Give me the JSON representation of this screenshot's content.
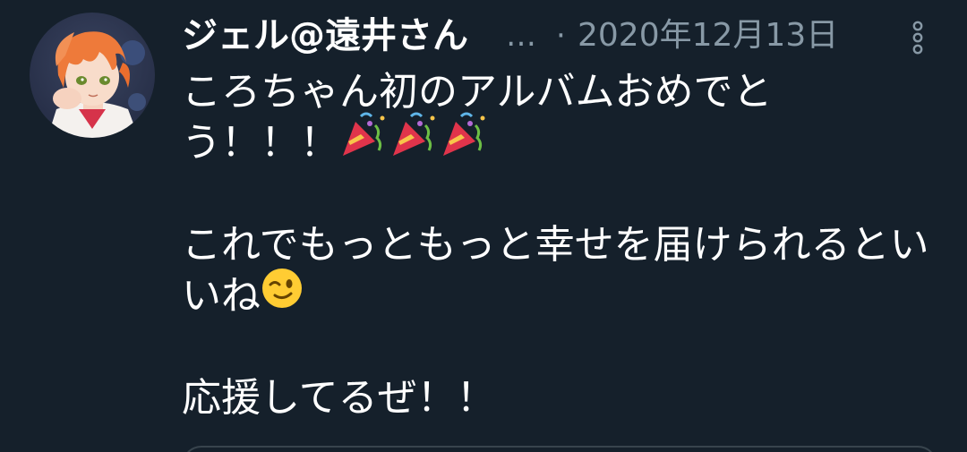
{
  "tweet": {
    "display_name": "ジェル@遠井さん",
    "name_truncation": "…",
    "separator": "·",
    "timestamp": "2020年12月13日",
    "lines": {
      "l1": "ころちゃん初のアルバムおめでと",
      "l2": "う！！！",
      "l4": "これでもっともっと幸せを届けられるとい",
      "l5": "いね",
      "l7": "応援してるぜ！！"
    },
    "icons": {
      "more": "more-vertical-icon",
      "party": "party-popper-emoji",
      "wink": "winking-face-emoji"
    }
  },
  "colors": {
    "background": "#15202b",
    "primary_text": "#ffffff",
    "secondary_text": "#8899a6",
    "border": "#38444d"
  }
}
